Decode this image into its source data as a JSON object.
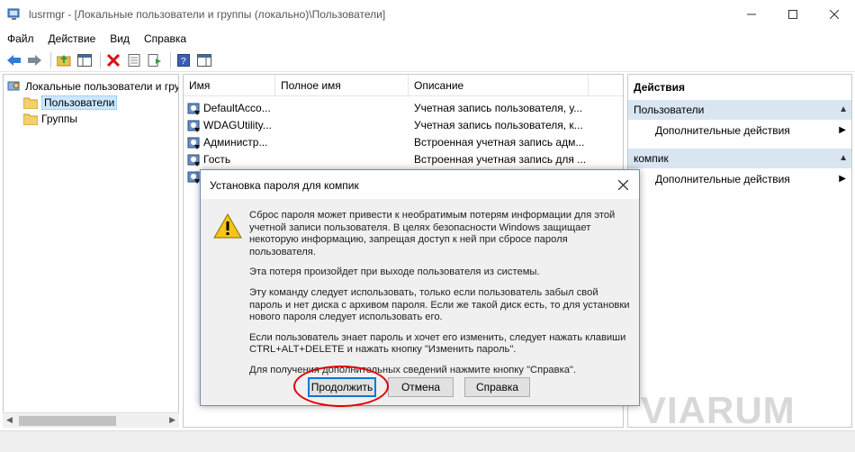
{
  "window": {
    "title": "lusrmgr - [Локальные пользователи и группы (локально)\\Пользователи]"
  },
  "menu": [
    "Файл",
    "Действие",
    "Вид",
    "Справка"
  ],
  "tree": {
    "root": "Локальные пользователи и группы (локально)",
    "children": [
      "Пользователи",
      "Группы"
    ]
  },
  "list": {
    "columns": [
      "Имя",
      "Полное имя",
      "Описание"
    ],
    "rows": [
      {
        "name": "DefaultAcco...",
        "fullname": "",
        "desc": "Учетная запись пользователя, у..."
      },
      {
        "name": "WDAGUtility...",
        "fullname": "",
        "desc": "Учетная запись пользователя, к..."
      },
      {
        "name": "Администр...",
        "fullname": "",
        "desc": "Встроенная учетная запись адм..."
      },
      {
        "name": "Гость",
        "fullname": "",
        "desc": "Встроенная учетная запись для ..."
      }
    ]
  },
  "actions": {
    "header": "Действия",
    "groups": [
      {
        "label": "Пользователи",
        "item": "Дополнительные действия"
      },
      {
        "label": "компик",
        "item": "Дополнительные действия"
      }
    ]
  },
  "dialog": {
    "title": "Установка пароля для компик",
    "paragraphs": [
      "Сброс пароля может привести к необратимым потерям информации для этой учетной записи пользователя. В целях безопасности Windows защищает некоторую информацию, запрещая доступ к ней при сбросе пароля пользователя.",
      "Эта потеря произойдет при выходе пользователя из системы.",
      "Эту команду следует использовать, только если пользователь забыл свой пароль и нет диска с архивом пароля. Если же такой диск есть, то для установки нового пароля следует использовать его.",
      "Если пользователь знает пароль и хочет его изменить, следует нажать клавиши CTRL+ALT+DELETE и нажать кнопку \"Изменить пароль\".",
      "Для получения дополнительных сведений нажмите кнопку \"Справка\"."
    ],
    "buttons": {
      "continue": "Продолжить",
      "cancel": "Отмена",
      "help": "Справка"
    }
  },
  "watermark": "VIARUM",
  "colors": {
    "accent": "#0078d7",
    "highlight_ring": "#e00000",
    "selection": "#cce8ff"
  }
}
